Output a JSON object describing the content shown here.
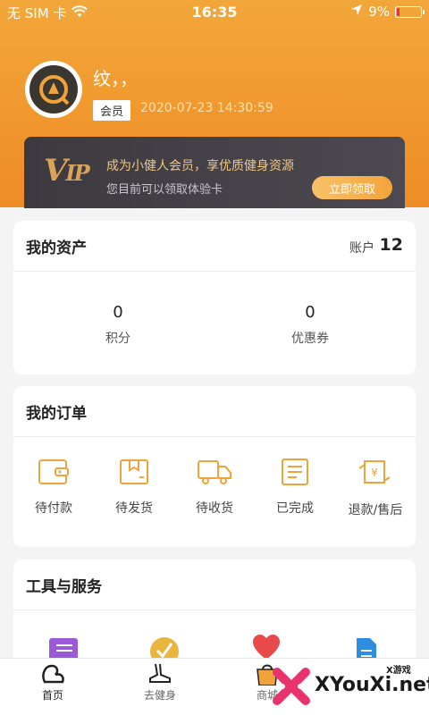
{
  "status_bar": {
    "carrier": "无 SIM 卡",
    "time": "16:35",
    "battery": "9%"
  },
  "profile": {
    "name": "纹，，",
    "member_badge": "会员",
    "timestamp": "2020-07-23 14:30:59"
  },
  "vip": {
    "logo": "VIP",
    "title": "成为小健人会员，享优质健身资源",
    "subtitle": "您目前可以领取体验卡",
    "button": "立即领取"
  },
  "assets": {
    "title": "我的资产",
    "account_label": "账户",
    "account_value": "12",
    "items": [
      {
        "value": "0",
        "label": "积分"
      },
      {
        "value": "0",
        "label": "优惠券"
      }
    ]
  },
  "orders": {
    "title": "我的订单",
    "items": [
      {
        "label": "待付款",
        "icon": "wallet-icon"
      },
      {
        "label": "待发货",
        "icon": "package-icon"
      },
      {
        "label": "待收货",
        "icon": "truck-icon"
      },
      {
        "label": "已完成",
        "icon": "document-icon"
      },
      {
        "label": "退款/售后",
        "icon": "refund-icon"
      }
    ]
  },
  "tools": {
    "title": "工具与服务",
    "items": [
      {
        "icon": "notebook-icon"
      },
      {
        "icon": "checkmark-icon"
      },
      {
        "icon": "heart-icon"
      },
      {
        "icon": "file-icon"
      }
    ]
  },
  "tabbar": {
    "items": [
      {
        "label": "首页",
        "icon": "home-icon"
      },
      {
        "label": "去健身",
        "icon": "fitness-icon"
      },
      {
        "label": "商城",
        "icon": "shop-bag-icon"
      }
    ]
  },
  "watermark": {
    "text": "XYouXi.net",
    "sub": "X游戏"
  },
  "colors": {
    "accent": "#f0992e",
    "vip_bg": "#3f3d42",
    "vip_text": "#f0c581",
    "icon": "#f0a33a"
  }
}
